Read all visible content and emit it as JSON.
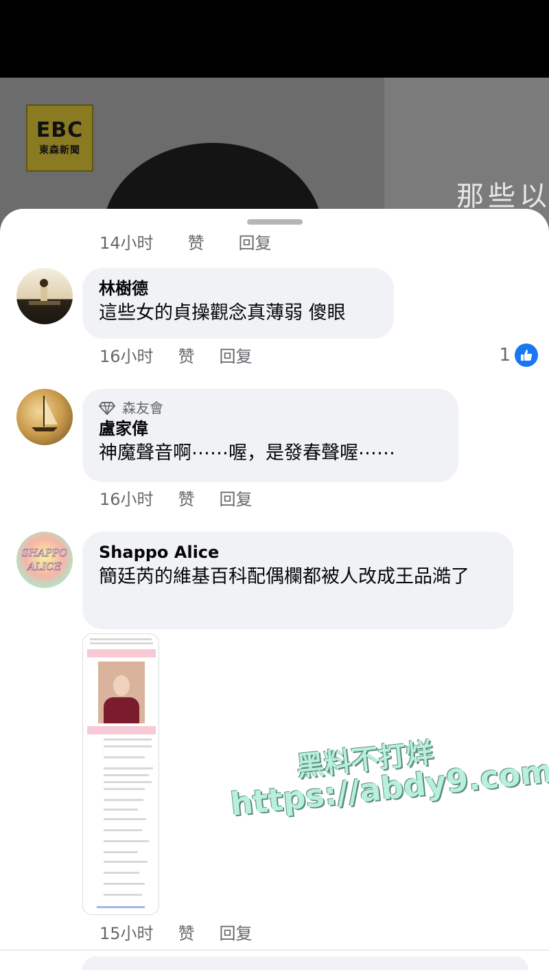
{
  "video": {
    "logo_top": "EBC",
    "logo_bottom": "東森新聞",
    "overlay_text": "那些以"
  },
  "cut_row": {
    "time": "14小时",
    "like": "赞",
    "reply": "回复"
  },
  "comments": [
    {
      "name": "林樹德",
      "text": "這些女的貞操觀念真薄弱 傻眼",
      "time": "16小时",
      "like": "赞",
      "reply": "回复",
      "reactions": "1"
    },
    {
      "badge": "森友會",
      "name": "盧家偉",
      "text": "神魔聲音啊⋯⋯喔，是發春聲喔⋯⋯",
      "time": "16小时",
      "like": "赞",
      "reply": "回复"
    },
    {
      "name": "Shappo Alice",
      "avatar_text": "SHAPPO ALICE",
      "text": "簡廷芮的維基百科配偶欄都被人改成王品澔了",
      "time": "15小时",
      "like": "赞",
      "reply": "回复"
    }
  ],
  "watermark": {
    "line1": "黑料不打烊",
    "line2": "https://abdy9.com"
  },
  "colors": {
    "bubble": "#f0f2f5",
    "meta": "#65676b",
    "like_blue": "#1877f2",
    "watermark": "#b9f0dc"
  }
}
